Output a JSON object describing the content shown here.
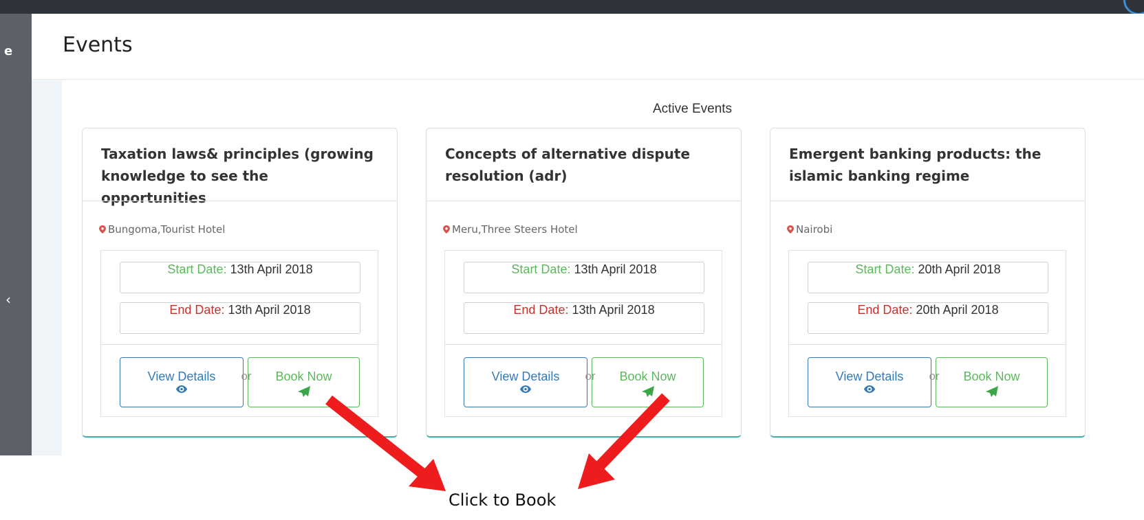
{
  "sidebar": {
    "label": "e",
    "chevron": "‹"
  },
  "header": {
    "title": "Events"
  },
  "section": {
    "title": "Active Events"
  },
  "events": [
    {
      "title": "Taxation laws& principles (growing knowledge to see the opportunities",
      "location": "Bungoma,Tourist Hotel",
      "start_label": "Start Date:",
      "start_value": "13th April 2018",
      "end_label": "End Date:",
      "end_value": "13th April 2018",
      "view_label": "View Details",
      "or": "or",
      "book_label": "Book Now"
    },
    {
      "title": "Concepts of alternative dispute resolution (adr)",
      "location": "Meru,Three Steers Hotel",
      "start_label": "Start Date:",
      "start_value": "13th April 2018",
      "end_label": "End Date:",
      "end_value": "13th April 2018",
      "view_label": "View Details",
      "or": "or",
      "book_label": "Book Now"
    },
    {
      "title": "Emergent banking products: the islamic banking regime",
      "location": "Nairobi",
      "start_label": "Start Date:",
      "start_value": "20th April 2018",
      "end_label": "End Date:",
      "end_value": "20th April 2018",
      "view_label": "View Details",
      "or": "or",
      "book_label": "Book Now"
    }
  ],
  "annotation": {
    "callout": "Click to Book"
  },
  "colors": {
    "topbar": "#2f343b",
    "sidebar": "#5b6167",
    "start_label": "#5cb85c",
    "end_label": "#c9302c",
    "view_button": "#337ab7",
    "book_button": "#5cb85c",
    "card_accent": "#3fb0a6",
    "arrow": "#ee1c1c"
  },
  "icons": {
    "location": "map-marker-icon",
    "view": "eye-icon",
    "book": "paper-plane-icon"
  }
}
